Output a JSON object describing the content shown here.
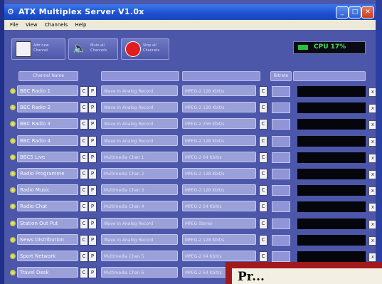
{
  "window": {
    "title": "ATX Multiplex Server V1.0x"
  },
  "menu": [
    "File",
    "View",
    "Channels",
    "Help"
  ],
  "toolbar": [
    {
      "label": "Add new Channel",
      "icon": "add-channel-icon"
    },
    {
      "label": "Mute all Channels",
      "icon": "speaker-icon"
    },
    {
      "label": "Stop all Channels",
      "icon": "stop-icon"
    }
  ],
  "cpu": {
    "label": "CPU 17%",
    "level": 0.17
  },
  "columns": [
    "Channel Name",
    "",
    "",
    "Bitrate",
    ""
  ],
  "channels": [
    {
      "name": "BBC Radio 1",
      "input": "Wave In Analog Record",
      "format": "MPEG-2 128 Kbit/s"
    },
    {
      "name": "BBC Radio 2",
      "input": "Wave In Analog Record",
      "format": "MPEG-2 128 Kbit/s"
    },
    {
      "name": "BBC Radio 3",
      "input": "Wave In Analog Record",
      "format": "MPEG-2 256 Kbit/s"
    },
    {
      "name": "BBC Radio 4",
      "input": "Wave In Analog Record",
      "format": "MPEG-2 128 Kbit/s"
    },
    {
      "name": "BBC5 Live",
      "input": "Multimedia Chan 1",
      "format": "MPEG-2 64 Kbit/s"
    },
    {
      "name": "Radio Programme",
      "input": "Multimedia Chan 2",
      "format": "MPEG-2 128 Kbit/s"
    },
    {
      "name": "Radio Music",
      "input": "Multimedia Chan 3",
      "format": "MPEG-2 128 Kbit/s"
    },
    {
      "name": "Radio Chat",
      "input": "Multimedia Chan 4",
      "format": "MPEG-2 64 Kbit/s"
    },
    {
      "name": "Station Out Put",
      "input": "Wave In Analog Record",
      "format": "MPEG Stereo"
    },
    {
      "name": "News Distribution",
      "input": "Wave In Analog Record",
      "format": "MPEG-2 128 Kbit/s"
    },
    {
      "name": "Sport Network",
      "input": "Multimedia Chan 5",
      "format": "MPEG-2 64 Kbit/s"
    },
    {
      "name": "Travel Desk",
      "input": "Multimedia Chan 6",
      "format": "MPEG-2 64 Kbit/s"
    }
  ],
  "row_button_labels": {
    "config": "C",
    "play": "P",
    "remove": "x"
  },
  "overlay": {
    "text": "Pr..."
  },
  "colors": {
    "body": "#4d57a9",
    "accent": "#1d4fd0",
    "meter": "#41e05a",
    "callout": "#a1191c"
  }
}
